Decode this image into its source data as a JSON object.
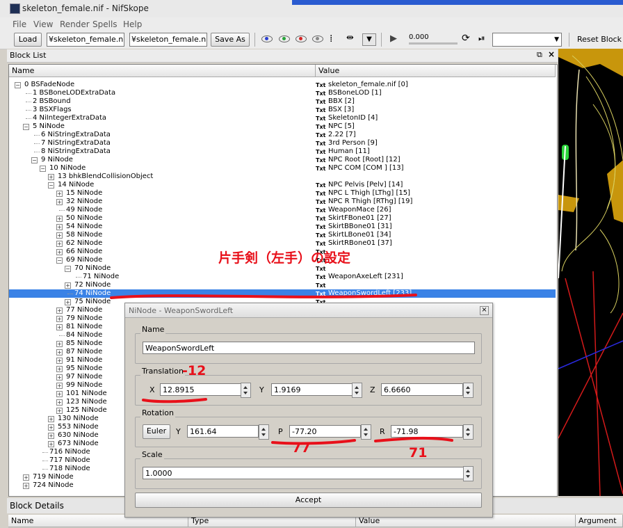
{
  "window": {
    "title": "skeleton_female.nif - NifSkope"
  },
  "menu": [
    "File",
    "View",
    "Render",
    "Spells",
    "Help"
  ],
  "toolbar": {
    "load_label": "Load",
    "load_path": "¥skeleton_female.nif",
    "save_path": "¥skeleton_female.nif",
    "save_as_label": "Save As",
    "time_value": "0.000",
    "reset_block_label": "Reset Block"
  },
  "block_list": {
    "title": "Block List",
    "col_name": "Name",
    "col_value": "Value",
    "type_tag": "Txt",
    "rows": [
      {
        "name": "0 BSFadeNode",
        "value": "skeleton_female.nif [0]",
        "indent": 0,
        "expander": "minus",
        "txt": true
      },
      {
        "name": "1 BSBoneLODExtraData",
        "value": "BSBoneLOD [1]",
        "indent": 1,
        "expander": "none",
        "txt": true
      },
      {
        "name": "2 BSBound",
        "value": "BBX [2]",
        "indent": 1,
        "expander": "none",
        "txt": true
      },
      {
        "name": "3 BSXFlags",
        "value": "BSX [3]",
        "indent": 1,
        "expander": "none",
        "txt": true
      },
      {
        "name": "4 NiIntegerExtraData",
        "value": "SkeletonID [4]",
        "indent": 1,
        "expander": "none",
        "txt": true
      },
      {
        "name": "5 NiNode",
        "value": "NPC [5]",
        "indent": 1,
        "expander": "minus",
        "txt": true
      },
      {
        "name": "6 NiStringExtraData",
        "value": "2.22 [7]",
        "indent": 2,
        "expander": "none",
        "txt": true
      },
      {
        "name": "7 NiStringExtraData",
        "value": "3rd Person [9]",
        "indent": 2,
        "expander": "none",
        "txt": true
      },
      {
        "name": "8 NiStringExtraData",
        "value": "Human [11]",
        "indent": 2,
        "expander": "none",
        "txt": true
      },
      {
        "name": "9 NiNode",
        "value": "NPC Root [Root] [12]",
        "indent": 2,
        "expander": "minus",
        "txt": true
      },
      {
        "name": "10 NiNode",
        "value": "NPC COM [COM ] [13]",
        "indent": 3,
        "expander": "minus",
        "txt": true
      },
      {
        "name": "13 bhkBlendCollisionObject",
        "value": "",
        "indent": 4,
        "expander": "plus",
        "txt": false
      },
      {
        "name": "14 NiNode",
        "value": "NPC Pelvis [Pelv] [14]",
        "indent": 4,
        "expander": "minus",
        "txt": true
      },
      {
        "name": "15 NiNode",
        "value": "NPC L Thigh [LThg] [15]",
        "indent": 5,
        "expander": "plus",
        "txt": true
      },
      {
        "name": "32 NiNode",
        "value": "NPC R Thigh [RThg] [19]",
        "indent": 5,
        "expander": "plus",
        "txt": true
      },
      {
        "name": "49 NiNode",
        "value": "WeaponMace [26]",
        "indent": 5,
        "expander": "none",
        "txt": true
      },
      {
        "name": "50 NiNode",
        "value": "SkirtFBone01 [27]",
        "indent": 5,
        "expander": "plus",
        "txt": true
      },
      {
        "name": "54 NiNode",
        "value": "SkirtBBone01 [31]",
        "indent": 5,
        "expander": "plus",
        "txt": true
      },
      {
        "name": "58 NiNode",
        "value": "SkirtLBone01 [34]",
        "indent": 5,
        "expander": "plus",
        "txt": true
      },
      {
        "name": "62 NiNode",
        "value": "SkirtRBone01 [37]",
        "indent": 5,
        "expander": "plus",
        "txt": true
      },
      {
        "name": "66 NiNode",
        "value": "",
        "indent": 5,
        "expander": "plus",
        "txt": true
      },
      {
        "name": "69 NiNode",
        "value": "",
        "indent": 5,
        "expander": "minus",
        "txt": true
      },
      {
        "name": "70 NiNode",
        "value": "",
        "indent": 6,
        "expander": "minus",
        "txt": true
      },
      {
        "name": "71 NiNode",
        "value": "WeaponAxeLeft [231]",
        "indent": 7,
        "expander": "none",
        "txt": true
      },
      {
        "name": "72 NiNode",
        "value": "",
        "indent": 6,
        "expander": "plus",
        "txt": true
      },
      {
        "name": "74 NiNode",
        "value": "WeaponSwordLeft [233]",
        "indent": 6,
        "expander": "none",
        "txt": true,
        "selected": true
      },
      {
        "name": "75 NiNode",
        "value": "",
        "indent": 6,
        "expander": "plus",
        "txt": true
      },
      {
        "name": "77 NiNode",
        "value": "",
        "indent": 5,
        "expander": "plus",
        "txt": false
      },
      {
        "name": "79 NiNode",
        "value": "",
        "indent": 5,
        "expander": "plus",
        "txt": false
      },
      {
        "name": "81 NiNode",
        "value": "",
        "indent": 5,
        "expander": "plus",
        "txt": false
      },
      {
        "name": "84 NiNode",
        "value": "",
        "indent": 5,
        "expander": "none",
        "txt": false
      },
      {
        "name": "85 NiNode",
        "value": "",
        "indent": 5,
        "expander": "plus",
        "txt": false
      },
      {
        "name": "87 NiNode",
        "value": "",
        "indent": 5,
        "expander": "plus",
        "txt": false
      },
      {
        "name": "91 NiNode",
        "value": "",
        "indent": 5,
        "expander": "plus",
        "txt": false
      },
      {
        "name": "95 NiNode",
        "value": "",
        "indent": 5,
        "expander": "plus",
        "txt": false
      },
      {
        "name": "97 NiNode",
        "value": "",
        "indent": 5,
        "expander": "plus",
        "txt": false
      },
      {
        "name": "99 NiNode",
        "value": "",
        "indent": 5,
        "expander": "plus",
        "txt": false
      },
      {
        "name": "101 NiNode",
        "value": "",
        "indent": 5,
        "expander": "plus",
        "txt": false
      },
      {
        "name": "123 NiNode",
        "value": "",
        "indent": 5,
        "expander": "plus",
        "txt": false
      },
      {
        "name": "125 NiNode",
        "value": "",
        "indent": 5,
        "expander": "plus",
        "txt": false
      },
      {
        "name": "130 NiNode",
        "value": "",
        "indent": 4,
        "expander": "plus",
        "txt": false
      },
      {
        "name": "553 NiNode",
        "value": "",
        "indent": 4,
        "expander": "plus",
        "txt": false
      },
      {
        "name": "630 NiNode",
        "value": "",
        "indent": 4,
        "expander": "plus",
        "txt": false
      },
      {
        "name": "673 NiNode",
        "value": "",
        "indent": 4,
        "expander": "plus",
        "txt": false
      },
      {
        "name": "716 NiNode",
        "value": "",
        "indent": 3,
        "expander": "none",
        "txt": false
      },
      {
        "name": "717 NiNode",
        "value": "",
        "indent": 3,
        "expander": "none",
        "txt": false
      },
      {
        "name": "718 NiNode",
        "value": "",
        "indent": 3,
        "expander": "none",
        "txt": false
      },
      {
        "name": "719 NiNode",
        "value": "",
        "indent": 1,
        "expander": "plus",
        "txt": false
      },
      {
        "name": "724 NiNode",
        "value": "",
        "indent": 1,
        "expander": "plus",
        "txt": false
      }
    ]
  },
  "block_details": {
    "title": "Block Details",
    "columns": [
      "Name",
      "Type",
      "Value",
      "Argument"
    ]
  },
  "dialog": {
    "title": "NiNode - WeaponSwordLeft",
    "name_group": "Name",
    "name_value": "WeaponSwordLeft",
    "translation_group": "Translation",
    "x_label": "X",
    "x_value": "12.8915",
    "y_label": "Y",
    "y_value": "1.9169",
    "z_label": "Z",
    "z_value": "6.6660",
    "rotation_group": "Rotation",
    "euler_label": "Euler",
    "ry_label": "Y",
    "ry_value": "161.64",
    "p_label": "P",
    "p_value": "-77.20",
    "r_label": "R",
    "r_value": "-71.98",
    "scale_group": "Scale",
    "scale_value": "1.0000",
    "accept_label": "Accept"
  },
  "annotations": {
    "heading": "片手剣（左手）の設定",
    "x_note": "-12",
    "p_note": "77",
    "r_note": "71",
    "color": "#e8101a"
  },
  "colors": {
    "selection": "#3a82e6",
    "titlebar_accent": "#2a5bd0"
  }
}
